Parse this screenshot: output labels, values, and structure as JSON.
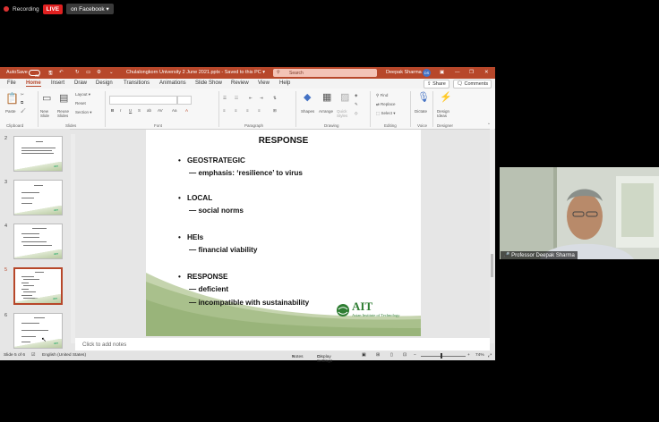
{
  "recording": {
    "label": "Recording",
    "live": "LIVE",
    "platform": "on Facebook",
    "caret": "▾"
  },
  "titlebar": {
    "autosave": "AutoSave",
    "autosave_state": "Off",
    "filename": "Chulalongkorn University 2 June 2021.pptx  -  Saved to this PC ▾",
    "search_placeholder": "Search",
    "user": "Deepak Sharma",
    "user_initials": "DS",
    "minimize": "—",
    "restore": "❐",
    "close": "✕"
  },
  "menu": {
    "tabs": [
      "File",
      "Home",
      "Insert",
      "Draw",
      "Design",
      "Transitions",
      "Animations",
      "Slide Show",
      "Review",
      "View",
      "Help"
    ],
    "share": "Share",
    "comments": "Comments"
  },
  "ribbon": {
    "groups": [
      "Clipboard",
      "Slides",
      "Font",
      "Paragraph",
      "Drawing",
      "Editing",
      "Voice",
      "Designer"
    ],
    "paste": "Paste",
    "new_slide": "New Slide",
    "reuse_slides": "Reuse Slides",
    "layout": "Layout ▾",
    "reset": "Reset",
    "section": "Section ▾",
    "shapes": "Shapes",
    "arrange": "Arrange",
    "quick_styles": "Quick Styles",
    "find": "Find",
    "replace": "Replace",
    "select": "Select ▾",
    "dictate": "Dictate",
    "design_ideas": "Design Ideas"
  },
  "thumbnails": [
    {
      "num": "2"
    },
    {
      "num": "3"
    },
    {
      "num": "4"
    },
    {
      "num": "5",
      "selected": true
    },
    {
      "num": "6"
    }
  ],
  "slide": {
    "title": "RESPONSE",
    "bullets": [
      {
        "head": "GEOSTRATEGIC",
        "sub": "— emphasis: ‘resilience’ to virus"
      },
      {
        "head": "LOCAL",
        "sub": "— social norms"
      },
      {
        "head": "HEIs",
        "sub": "— financial viability"
      },
      {
        "head": "RESPONSE",
        "sub1": "— deficient",
        "sub2": "— incompatible with sustainability"
      }
    ],
    "bullet_char": "•",
    "logo_text": "AIT",
    "logo_sub": "Asian Institute of Technology"
  },
  "notes": {
    "placeholder": "Click to add notes"
  },
  "status": {
    "slide_pos": "Slide 5 of 6",
    "language": "English (United States)",
    "notes": "Notes",
    "display_settings": "Display Settings",
    "zoom": "74%"
  },
  "webcam": {
    "name": "Professor Deepak Sharma"
  },
  "colors": {
    "accent": "#b7472a",
    "live": "#e02020",
    "ait_green": "#2e7d32"
  }
}
